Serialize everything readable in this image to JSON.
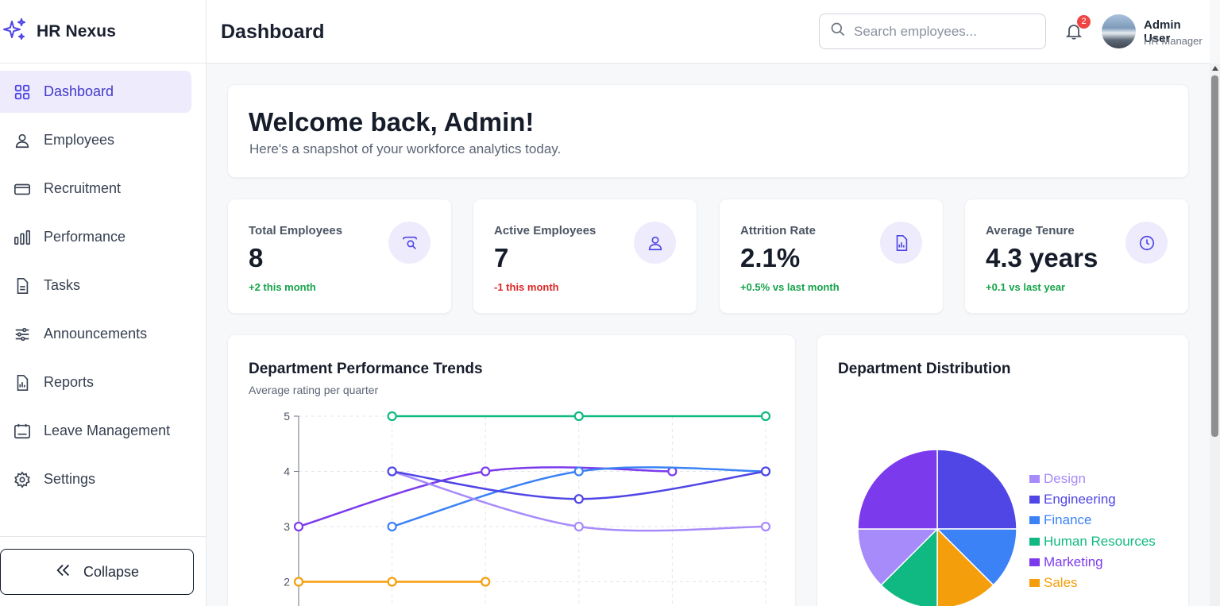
{
  "brand": {
    "name": "HR Nexus"
  },
  "sidebar": {
    "items": [
      {
        "label": "Dashboard",
        "icon": "grid-icon",
        "active": true
      },
      {
        "label": "Employees",
        "icon": "user-icon"
      },
      {
        "label": "Recruitment",
        "icon": "wallet-icon"
      },
      {
        "label": "Performance",
        "icon": "bar-chart-icon"
      },
      {
        "label": "Tasks",
        "icon": "document-icon"
      },
      {
        "label": "Announcements",
        "icon": "sliders-icon"
      },
      {
        "label": "Reports",
        "icon": "report-icon"
      },
      {
        "label": "Leave Management",
        "icon": "calendar-icon"
      },
      {
        "label": "Settings",
        "icon": "gear-icon"
      }
    ],
    "collapse_label": "Collapse"
  },
  "header": {
    "title": "Dashboard",
    "search_placeholder": "Search employees...",
    "notification_count": "2",
    "user_name": "Admin User",
    "user_role": "HR Manager"
  },
  "welcome": {
    "title": "Welcome back, Admin!",
    "subtitle": "Here's a snapshot of your workforce analytics today."
  },
  "stats": [
    {
      "label": "Total Employees",
      "value": "8",
      "change": "+2 this month",
      "trend": "positive",
      "icon": "users-search-icon"
    },
    {
      "label": "Active Employees",
      "value": "7",
      "change": "-1 this month",
      "trend": "negative",
      "icon": "user-icon"
    },
    {
      "label": "Attrition Rate",
      "value": "2.1%",
      "change": "+0.5% vs last month",
      "trend": "positive",
      "icon": "report-icon"
    },
    {
      "label": "Average Tenure",
      "value": "4.3 years",
      "change": "+0.1 vs last year",
      "trend": "positive",
      "icon": "clock-icon"
    }
  ],
  "colors": {
    "accent": "#4f46e5",
    "accent_bg": "#eeecfc",
    "positive": "#16a34a",
    "negative": "#dc2626"
  },
  "chart_data": [
    {
      "type": "line",
      "title": "Department Performance Trends",
      "subtitle": "Average rating per quarter",
      "ylim": [
        1,
        5
      ],
      "yticks": [
        2,
        3,
        4,
        5
      ],
      "grid": true,
      "x": [
        0,
        1,
        2,
        3,
        4,
        5
      ],
      "series": [
        {
          "color": "#f59e0b",
          "values": [
            2,
            2,
            2,
            null,
            null,
            null
          ]
        },
        {
          "color": "#7c3aed",
          "values": [
            3,
            null,
            4,
            null,
            4,
            null
          ]
        },
        {
          "color": "#3b82f6",
          "values": [
            null,
            3,
            null,
            4,
            null,
            4
          ]
        },
        {
          "color": "#a78bfa",
          "values": [
            null,
            4,
            null,
            3,
            null,
            3
          ]
        },
        {
          "color": "#4f46e5",
          "values": [
            null,
            4,
            null,
            3.5,
            null,
            4
          ]
        },
        {
          "color": "#10b981",
          "values": [
            null,
            5,
            null,
            5,
            null,
            5
          ]
        }
      ]
    },
    {
      "type": "pie",
      "title": "Department Distribution",
      "legend_position": "right",
      "slices": [
        {
          "label": "Design",
          "value": 1,
          "color": "#a78bfa"
        },
        {
          "label": "Engineering",
          "value": 2,
          "color": "#4f46e5"
        },
        {
          "label": "Finance",
          "value": 1,
          "color": "#3b82f6"
        },
        {
          "label": "Human Resources",
          "value": 1,
          "color": "#10b981"
        },
        {
          "label": "Marketing",
          "value": 2,
          "color": "#7c3aed"
        },
        {
          "label": "Sales",
          "value": 1,
          "color": "#f59e0b"
        }
      ]
    }
  ]
}
